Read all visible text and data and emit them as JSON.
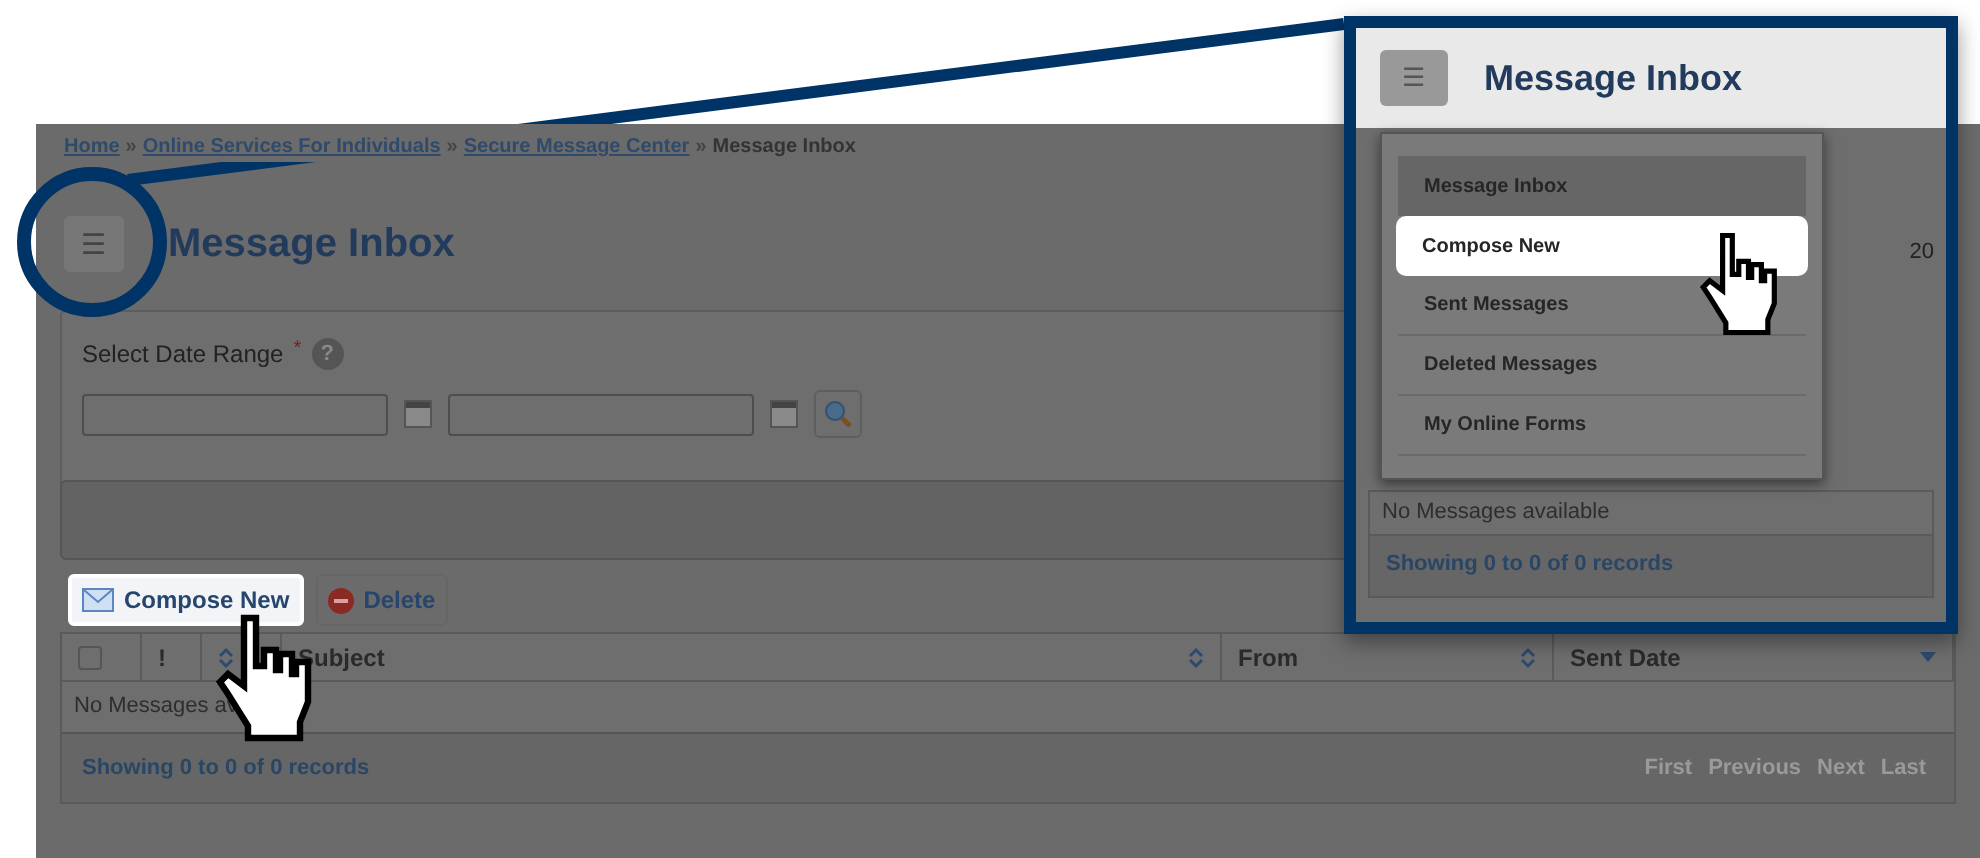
{
  "breadcrumb": [
    "Home",
    "Online Services For Individuals",
    "Secure Message Center"
  ],
  "breadcrumb_separator": "»",
  "breadcrumb_current": "Message Inbox",
  "menu_button": {
    "label": "☰"
  },
  "title": "Message Inbox",
  "filter": {
    "label": "Select Date Range",
    "required_mark": "*",
    "help": "?",
    "fields": [
      {
        "kind": "date"
      },
      {
        "kind": "date"
      }
    ]
  },
  "toolbar": [
    {
      "kind": "compose",
      "label": "Compose New",
      "highlighted": true
    },
    {
      "kind": "delete",
      "label": "Delete",
      "highlighted": false
    }
  ],
  "table": {
    "columns": [
      {
        "kind": "checkbox",
        "checked": false
      },
      {
        "kind": "text",
        "label": "!"
      },
      {
        "kind": "sort"
      },
      {
        "kind": "text",
        "label": "Subject",
        "sorted": false
      },
      {
        "kind": "text",
        "label": "From",
        "sorted": false
      },
      {
        "kind": "text",
        "label": "Sent Date",
        "sorted": true
      }
    ],
    "empty_text": "No Messages av",
    "footer": "Showing 0 to 0 of 0 records",
    "pager": [
      {
        "label": "First",
        "disabled": true
      },
      {
        "label": "Previous",
        "disabled": true
      },
      {
        "label": "Next",
        "disabled": true
      },
      {
        "label": "Last",
        "disabled": true
      }
    ]
  },
  "callout": {
    "menu_button": "☰",
    "title": "Message Inbox",
    "field_value": "20",
    "menu": [
      {
        "label": "Message Inbox",
        "selected": true,
        "highlighted": false
      },
      {
        "label": "Compose New",
        "selected": false,
        "highlighted": true
      },
      {
        "label": "Sent Messages",
        "selected": false,
        "highlighted": false
      },
      {
        "label": "Deleted Messages",
        "selected": false,
        "highlighted": false
      },
      {
        "label": "My Online Forms",
        "selected": false,
        "highlighted": false
      }
    ],
    "empty_text": "No Messages available",
    "footer": "Showing 0 to 0 of 0 records"
  }
}
